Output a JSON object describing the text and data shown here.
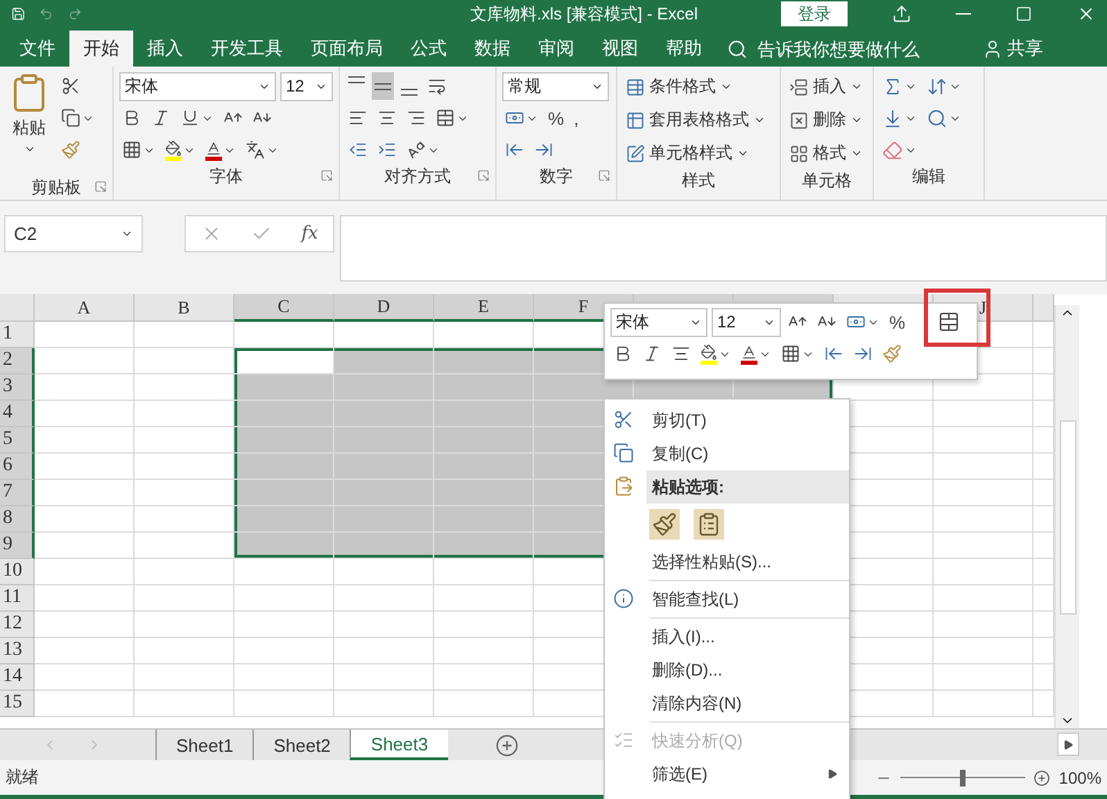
{
  "title_bar": {
    "title": "文库物料.xls  [兼容模式]  -  Excel",
    "login": "登录"
  },
  "tabs": [
    {
      "label": "文件",
      "selected": false
    },
    {
      "label": "开始",
      "selected": true
    },
    {
      "label": "插入",
      "selected": false
    },
    {
      "label": "开发工具",
      "selected": false
    },
    {
      "label": "页面布局",
      "selected": false
    },
    {
      "label": "公式",
      "selected": false
    },
    {
      "label": "数据",
      "selected": false
    },
    {
      "label": "审阅",
      "selected": false
    },
    {
      "label": "视图",
      "selected": false
    },
    {
      "label": "帮助",
      "selected": false
    }
  ],
  "tell_me": {
    "placeholder": "告诉我你想要做什么"
  },
  "share": "共享",
  "ribbon": {
    "clipboard": {
      "paste": "粘贴",
      "label": "剪贴板"
    },
    "font": {
      "font_name": "宋体",
      "font_size": "12",
      "label": "字体"
    },
    "alignment": {
      "vertical_buttons": [
        {
          "selected": false
        },
        {
          "selected": true
        },
        {
          "selected": false
        }
      ],
      "label": "对齐方式"
    },
    "number": {
      "format": "常规",
      "percent": "%",
      "comma": ",",
      "label": "数字"
    },
    "styles": {
      "items": [
        "条件格式",
        "套用表格格式",
        "单元格样式"
      ],
      "label": "样式"
    },
    "cells": {
      "items": [
        "插入",
        "删除",
        "格式"
      ],
      "label": "单元格"
    },
    "editing": {
      "label": "编辑"
    }
  },
  "formula_bar": {
    "name_box": "C2",
    "fx": "fx"
  },
  "sheet": {
    "columns": [
      {
        "label": "A",
        "selected": false
      },
      {
        "label": "B",
        "selected": false
      },
      {
        "label": "C",
        "selected": true
      },
      {
        "label": "D",
        "selected": true
      },
      {
        "label": "E",
        "selected": true
      },
      {
        "label": "F",
        "selected": true
      },
      {
        "selected": true
      },
      {
        "selected": true
      },
      {
        "selected": false
      },
      {
        "label": "J",
        "selected": false
      },
      {
        "selected": false
      }
    ],
    "rows": [
      {
        "label": "1",
        "selected": false
      },
      {
        "label": "2",
        "selected": true
      },
      {
        "label": "3",
        "selected": true
      },
      {
        "label": "4",
        "selected": true
      },
      {
        "label": "5",
        "selected": true
      },
      {
        "label": "6",
        "selected": true
      },
      {
        "label": "7",
        "selected": true
      },
      {
        "label": "8",
        "selected": true
      },
      {
        "label": "9",
        "selected": true
      },
      {
        "label": "10",
        "selected": false
      },
      {
        "label": "11",
        "selected": false
      },
      {
        "label": "12",
        "selected": false
      },
      {
        "label": "13",
        "selected": false
      },
      {
        "label": "14",
        "selected": false
      },
      {
        "label": "15",
        "selected": false
      }
    ]
  },
  "sheet_tabs": [
    {
      "label": "Sheet1",
      "selected": false
    },
    {
      "label": "Sheet2",
      "selected": false
    },
    {
      "label": "Sheet3",
      "selected": true
    }
  ],
  "status_bar": {
    "text": "就绪",
    "zoom": "100%",
    "zoom_slider": {
      "level": 0.5
    }
  },
  "mini_toolbar": {
    "font_name": "宋体",
    "font_size": "12",
    "percent": "%",
    "merge_highlighted": true
  },
  "context_menu": {
    "items": [
      {
        "kind": "command",
        "label": "剪切(T)",
        "disabled": false
      },
      {
        "kind": "command",
        "label": "复制(C)",
        "disabled": false
      },
      {
        "kind": "header",
        "label": "粘贴选项:"
      },
      {
        "kind": "paste_icons"
      },
      {
        "kind": "command",
        "label": "选择性粘贴(S)...",
        "disabled": false
      },
      {
        "kind": "separator"
      },
      {
        "kind": "command",
        "label": "智能查找(L)",
        "disabled": false
      },
      {
        "kind": "separator"
      },
      {
        "kind": "command",
        "label": "插入(I)...",
        "disabled": false
      },
      {
        "kind": "command",
        "label": "删除(D)...",
        "disabled": false
      },
      {
        "kind": "command",
        "label": "清除内容(N)",
        "disabled": false
      },
      {
        "kind": "separator"
      },
      {
        "kind": "command",
        "label": "快速分析(Q)",
        "disabled": true
      },
      {
        "kind": "submenu",
        "label": "筛选(E)",
        "disabled": false
      }
    ]
  }
}
